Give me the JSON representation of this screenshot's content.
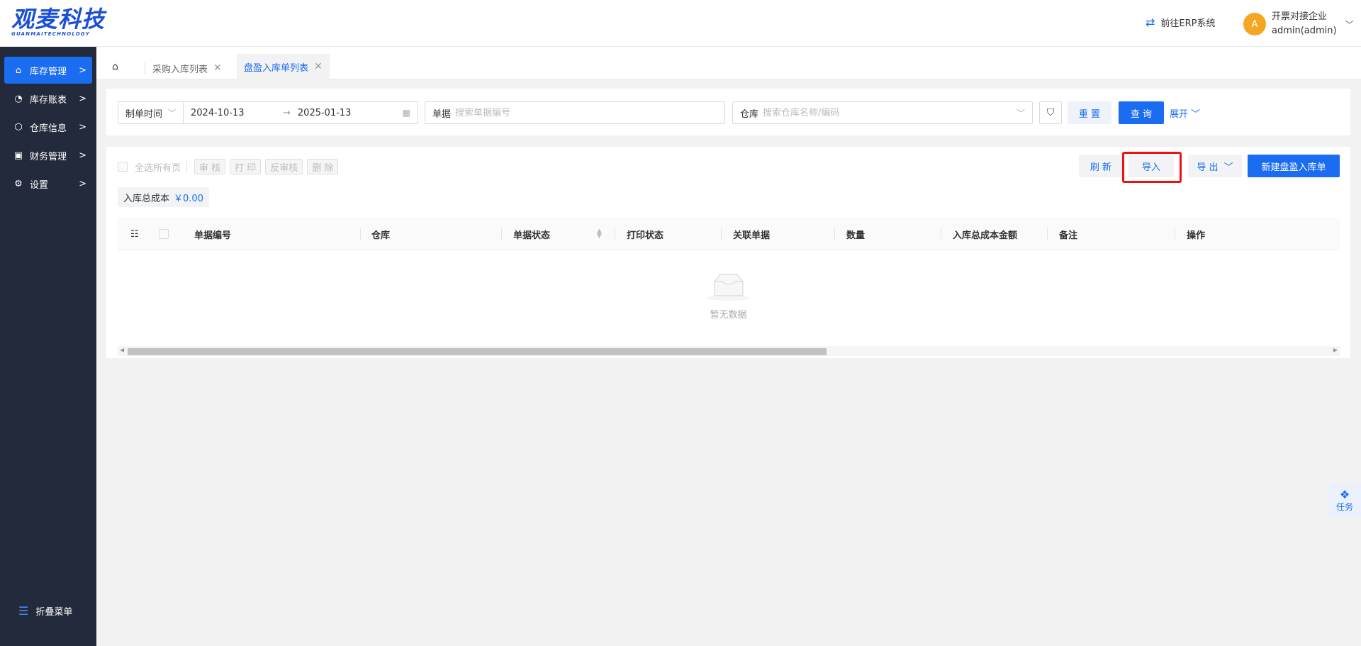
{
  "brand": {
    "name_cn": "观麦科技",
    "name_en": "GUANMAITECHNOLOGY"
  },
  "header": {
    "erp_link": "前往ERP系统",
    "avatar_letter": "A",
    "company": "开票对接企业",
    "username": "admin(admin)"
  },
  "sidebar": {
    "items": [
      {
        "label": "库存管理",
        "icon": "warehouse-icon",
        "active": true
      },
      {
        "label": "库存账表",
        "icon": "pie-chart-icon",
        "active": false
      },
      {
        "label": "仓库信息",
        "icon": "cube-icon",
        "active": false
      },
      {
        "label": "财务管理",
        "icon": "finance-icon",
        "active": false
      },
      {
        "label": "设置",
        "icon": "gear-icon",
        "active": false
      }
    ],
    "fold_label": "折叠菜单"
  },
  "tabs": [
    {
      "label": "采购入库列表",
      "active": false
    },
    {
      "label": "盘盈入库单列表",
      "active": true
    }
  ],
  "search": {
    "time_type": "制单时间",
    "date_start": "2024-10-13",
    "date_end": "2025-01-13",
    "doc_label": "单据",
    "doc_placeholder": "搜索单据编号",
    "warehouse_label": "仓库",
    "warehouse_placeholder": "搜索仓库名称/编码",
    "reset": "重 置",
    "query": "查 询",
    "expand": "展开"
  },
  "toolbar": {
    "select_all_pages": "全选所有页",
    "audit": "审 核",
    "print": "打 印",
    "unaudit": "反审核",
    "delete": "删 除",
    "refresh": "刷 新",
    "import": "导入",
    "export": "导 出",
    "new": "新建盘盈入库单"
  },
  "summary": {
    "label": "入库总成本",
    "value": "￥0.00"
  },
  "table": {
    "columns": [
      "单据编号",
      "仓库",
      "单据状态",
      "打印状态",
      "关联单据",
      "数量",
      "入库总成本金额",
      "备注",
      "操作"
    ],
    "rows": [],
    "empty_text": "暂无数据"
  },
  "task_float": {
    "label": "任务"
  },
  "colors": {
    "primary": "#1a6cf0",
    "sidebar_bg": "#232a3b",
    "highlight": "#ee1111",
    "avatar": "#f5a623"
  }
}
